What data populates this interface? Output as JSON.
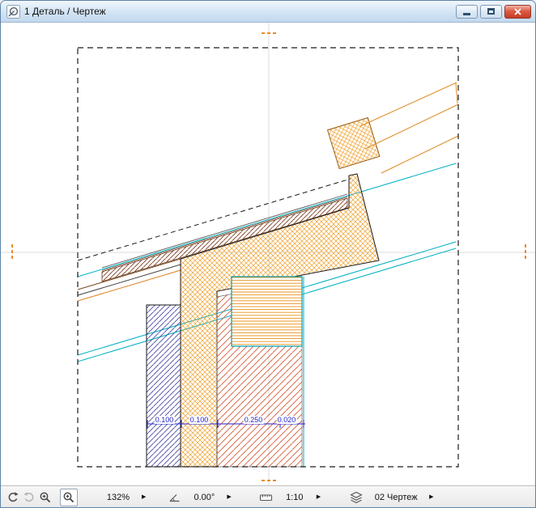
{
  "window": {
    "title": "1 Деталь / Чертеж"
  },
  "canvas": {
    "dimension_labels": [
      "0.100",
      "0.100",
      "0.250",
      "0.020"
    ]
  },
  "statusbar": {
    "zoom_value": "132%",
    "angle_value": "0.00°",
    "scale_value": "1:10",
    "layer_value": "02 Чертеж",
    "flyout_arrow": "▶"
  },
  "icons": {
    "titlebar": "detail-drawing-icon",
    "zoom_previous": "zoom-previous-icon",
    "zoom_next": "zoom-next-icon",
    "zoom_in": "zoom-in-icon",
    "zoom_window": "zoom-window-icon",
    "angle": "angle-icon",
    "scale": "ruler-icon",
    "layer": "layers-icon"
  },
  "colors": {
    "hatch_orange": "#efa02c",
    "hatch_navy": "#4646a0",
    "hatch_red": "#d4502a",
    "line_cyan": "#00b0c4",
    "dimension_blue": "#2222cc",
    "marker_orange": "#f08a24",
    "close_button_red": "#c53b24"
  }
}
